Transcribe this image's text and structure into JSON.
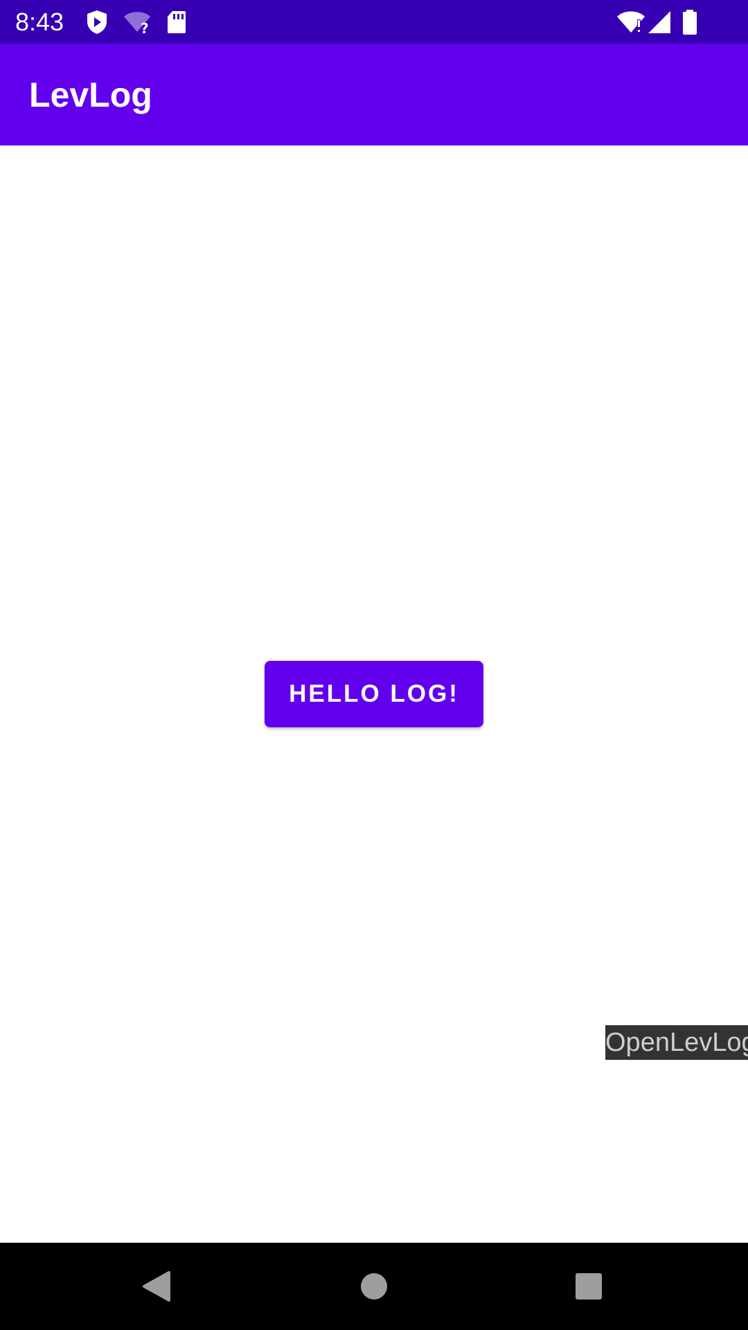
{
  "status_bar": {
    "time": "8:43",
    "icons_left": [
      "shield-play-icon",
      "wifi-unknown-icon",
      "sd-card-icon"
    ],
    "icons_right": [
      "wifi-alert-icon",
      "cell-signal-icon",
      "battery-icon"
    ],
    "background": "#3700b3"
  },
  "app_bar": {
    "title": "LevLog",
    "background": "#6200ee"
  },
  "main": {
    "hello_button_label": "HELLO LOG!",
    "open_levlog_label": "OpenLevLog"
  },
  "nav_bar": {
    "buttons": [
      "back-icon",
      "home-icon",
      "recents-icon"
    ]
  },
  "colors": {
    "primary": "#6200ee",
    "primary_dark": "#3700b3",
    "overlay": "#333333"
  }
}
